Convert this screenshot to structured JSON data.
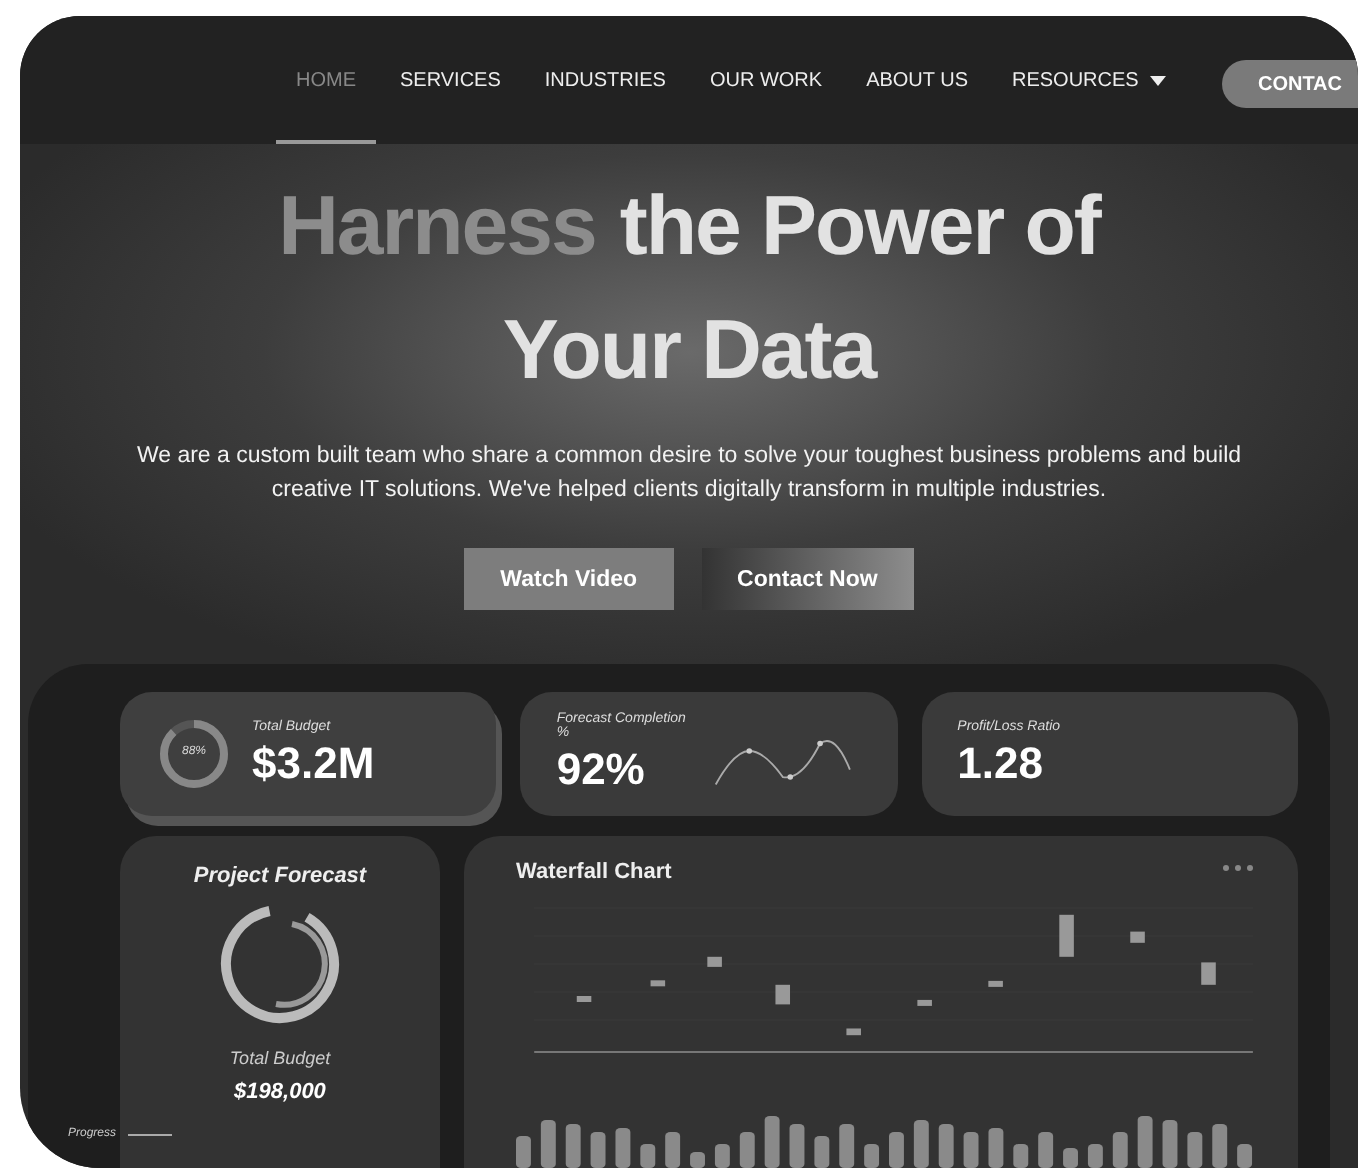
{
  "nav": {
    "items": [
      {
        "label": "HOME",
        "selected": true,
        "kind": "link"
      },
      {
        "label": "SERVICES",
        "selected": false,
        "kind": "link"
      },
      {
        "label": "INDUSTRIES",
        "selected": false,
        "kind": "link"
      },
      {
        "label": "OUR WORK",
        "selected": false,
        "kind": "link"
      },
      {
        "label": "ABOUT US",
        "selected": false,
        "kind": "link"
      },
      {
        "label": "RESOURCES",
        "selected": false,
        "kind": "dropdown"
      }
    ],
    "contact_button": "CONTAC"
  },
  "hero": {
    "title_lines": [
      {
        "segments": [
          {
            "text": "Harness",
            "dim": true
          },
          {
            "text": "the Power of",
            "dim": false
          }
        ]
      },
      {
        "segments": [
          {
            "text": "Your Data",
            "dim": false
          }
        ]
      }
    ],
    "description": "We are a custom built team who share a common desire to solve your toughest business problems and build creative IT solutions. We've helped clients digitally transform in multiple industries.",
    "buttons": [
      {
        "label": "Watch Video",
        "kind": "solid"
      },
      {
        "label": "Contact Now",
        "kind": "gradient"
      }
    ]
  },
  "dashboard": {
    "stats": [
      {
        "kind": "ring",
        "label": "Total Budget",
        "value": "$3.2M",
        "ring_text": "88%",
        "level": 0.88
      },
      {
        "kind": "sparkline",
        "label": "Forecast Completion %",
        "value": "92%"
      },
      {
        "kind": "plain",
        "label": "Profit/Loss Ratio",
        "value": "1.28"
      }
    ],
    "forecast": {
      "title": "Project Forecast",
      "budget_label": "Total Budget",
      "budget_value": "$198,000",
      "progress_label": "Progress"
    },
    "waterfall": {
      "title": "Waterfall Chart"
    }
  }
}
